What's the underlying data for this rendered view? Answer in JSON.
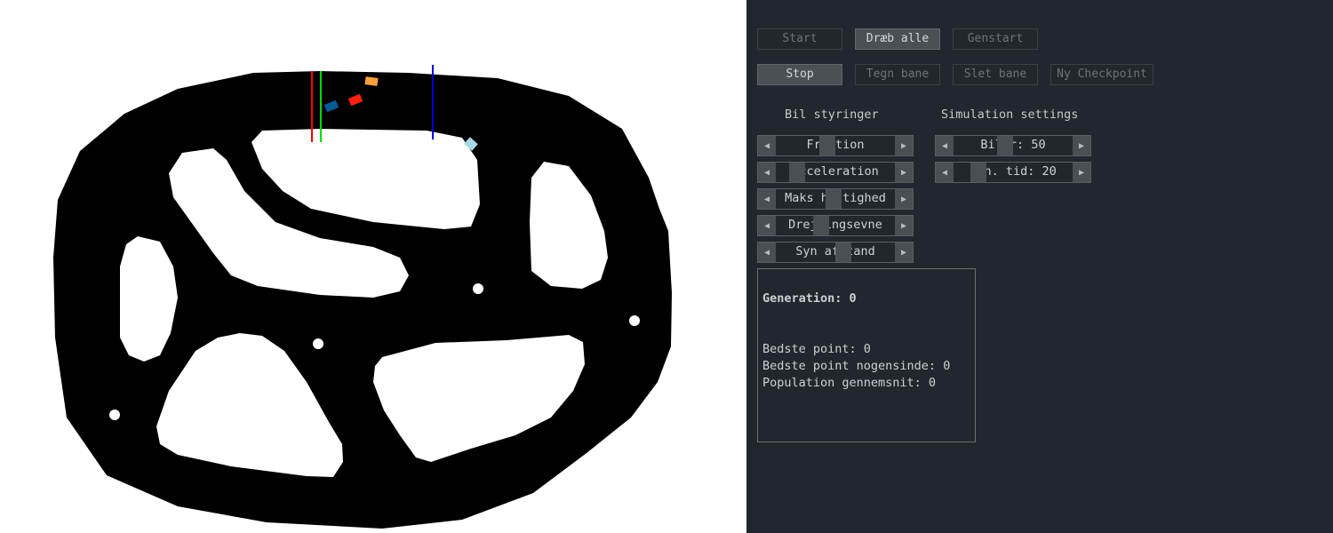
{
  "colors": {
    "panel_bg": "#21272e",
    "track": "#000000",
    "offtrack": "#ffffff",
    "start_line": "#ff0000",
    "finish_line": "#00dd00",
    "checkpoint_line": "#0000dd"
  },
  "buttons": {
    "row1": [
      {
        "label": "Start",
        "active": false
      },
      {
        "label": "Dræb alle",
        "active": true
      },
      {
        "label": "Genstart",
        "active": false
      }
    ],
    "row2": [
      {
        "label": "Stop",
        "active": true
      },
      {
        "label": "Tegn bane",
        "active": false
      },
      {
        "label": "Slet bane",
        "active": false
      },
      {
        "label": "Ny Checkpoint",
        "active": false
      }
    ]
  },
  "car_controls": {
    "title": "Bil styringer",
    "sliders": [
      {
        "label": "Friction",
        "value_fraction": 0.42,
        "left_icon": "arrow-left-icon",
        "right_icon": "arrow-right-icon"
      },
      {
        "label": "Acceleration",
        "value_fraction": 0.13,
        "left_icon": "arrow-left-icon",
        "right_icon": "arrow-right-icon"
      },
      {
        "label": "Maks hastighed",
        "value_fraction": 0.48,
        "left_icon": "arrow-left-icon",
        "right_icon": "arrow-right-icon"
      },
      {
        "label": "Drejningsevne",
        "value_fraction": 0.36,
        "left_icon": "arrow-left-icon",
        "right_icon": "arrow-right-icon"
      },
      {
        "label": "Syn afstand",
        "value_fraction": 0.58,
        "left_icon": "arrow-left-icon",
        "right_icon": "arrow-right-icon"
      }
    ]
  },
  "simulation_settings": {
    "title": "Simulation settings",
    "sliders": [
      {
        "label": "Biler: 50",
        "value_fraction": 0.42,
        "left_icon": "arrow-left-icon",
        "right_icon": "arrow-right-icon"
      },
      {
        "label": "Gen. tid: 20",
        "value_fraction": 0.16,
        "left_icon": "arrow-left-icon",
        "right_icon": "arrow-right-icon"
      }
    ]
  },
  "stats": {
    "generation": "Generation: 0",
    "best_points": "Bedste point: 0",
    "best_points_ever": "Bedste point nogensinde: 0",
    "population_average": "Population gennemsnit: 0"
  },
  "cars": [
    {
      "name": "car-dark-blue",
      "color": "#0a5a96"
    },
    {
      "name": "car-red",
      "color": "#ff2010"
    },
    {
      "name": "car-orange",
      "color": "#ffa040"
    },
    {
      "name": "car-light-blue",
      "color": "#a8d8e6"
    }
  ]
}
